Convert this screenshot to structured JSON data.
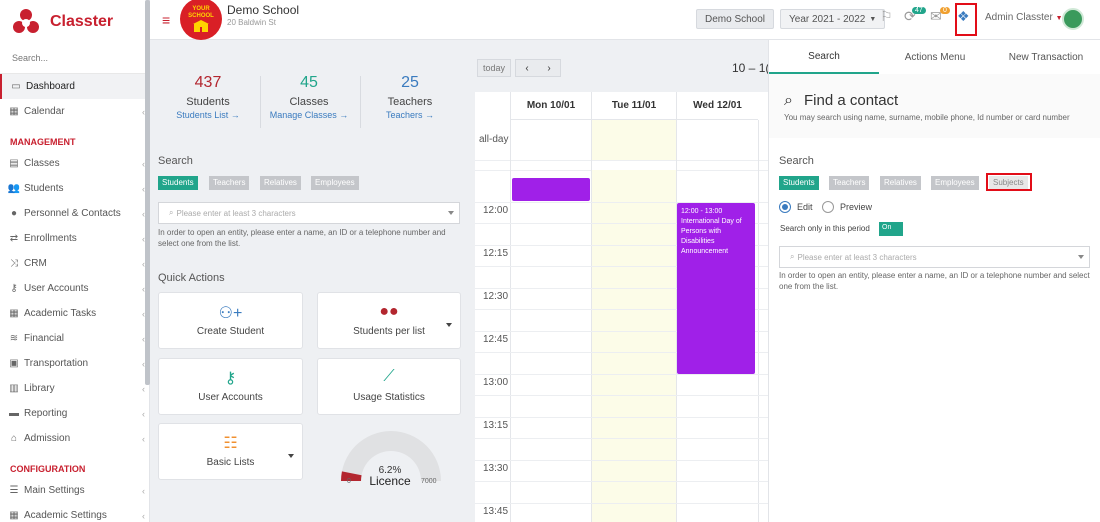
{
  "app": {
    "brand": "Classter"
  },
  "sidebar": {
    "search_placeholder": "Search...",
    "items": [
      {
        "label": "Dashboard"
      },
      {
        "label": "Calendar"
      },
      {
        "label": "Classes"
      },
      {
        "label": "Students"
      },
      {
        "label": "Personnel & Contacts"
      },
      {
        "label": "Enrollments"
      },
      {
        "label": "CRM"
      },
      {
        "label": "User Accounts"
      },
      {
        "label": "Academic Tasks"
      },
      {
        "label": "Financial"
      },
      {
        "label": "Transportation"
      },
      {
        "label": "Library"
      },
      {
        "label": "Reporting"
      },
      {
        "label": "Admission"
      },
      {
        "label": "Main Settings"
      },
      {
        "label": "Academic Settings"
      }
    ],
    "sections": {
      "management": "MANAGEMENT",
      "configuration": "CONFIGURATION"
    }
  },
  "topbar": {
    "school_name": "Demo School",
    "school_address": "20 Baldwin St",
    "logo_text": "YOUR SCHOOL",
    "school_pill": "Demo School",
    "year_pill": "Year 2021 - 2022",
    "badge_tasks": "47",
    "badge_mail": "0",
    "user": "Admin Classter"
  },
  "stats": [
    {
      "value": "437",
      "label": "Students",
      "link": "Students List →",
      "color": "#b3262f"
    },
    {
      "value": "45",
      "label": "Classes",
      "link": "Manage Classes →",
      "color": "#21a58b"
    },
    {
      "value": "25",
      "label": "Teachers",
      "link": "Teachers →",
      "color": "#3a7bbf"
    }
  ],
  "dash_search": {
    "title": "Search",
    "tabs": [
      "Students",
      "Teachers",
      "Relatives",
      "Employees"
    ],
    "placeholder": "Please enter at least 3 characters",
    "help": "In order to open an entity, please enter a name, an ID or a telephone number and select one from the list."
  },
  "quick_actions": {
    "title": "Quick Actions",
    "cards": [
      {
        "label": "Create Student"
      },
      {
        "label": "Students per list"
      },
      {
        "label": "User Accounts"
      },
      {
        "label": "Usage Statistics"
      },
      {
        "label": "Basic Lists"
      }
    ]
  },
  "licence": {
    "percent": "6.2%",
    "label": "Licence",
    "min": "0",
    "max": "7000",
    "fraction": 0.062
  },
  "calendar": {
    "today": "today",
    "range": "10 – 1(",
    "days": [
      "Mon 10/01",
      "Tue 11/01",
      "Wed 12/01"
    ],
    "allday": "all-day",
    "times": [
      "12:00",
      "12:15",
      "12:30",
      "12:45",
      "13:00",
      "13:15",
      "13:30",
      "13:45"
    ],
    "event": {
      "time": "12:00 - 13:00",
      "title": "International Day of Persons with Disabilities Announcement"
    }
  },
  "panel": {
    "tabs": [
      "Search",
      "Actions Menu",
      "New Transaction"
    ],
    "title": "Find a contact",
    "subtitle": "You may search using name, surname, mobile phone, Id number or card number",
    "search_title": "Search",
    "filters": [
      "Students",
      "Teachers",
      "Relatives",
      "Employees",
      "Subjects"
    ],
    "mode_edit": "Edit",
    "mode_preview": "Preview",
    "period_label": "Search only in this period",
    "toggle": "On",
    "placeholder": "Please enter at least 3 characters",
    "help": "In order to open an entity, please enter a name, an ID or a telephone number and select one from the list."
  },
  "colors": {
    "accent": "#c8202f",
    "teal": "#21a58b",
    "event": "#a020e8",
    "highlight": "#e20d18"
  }
}
